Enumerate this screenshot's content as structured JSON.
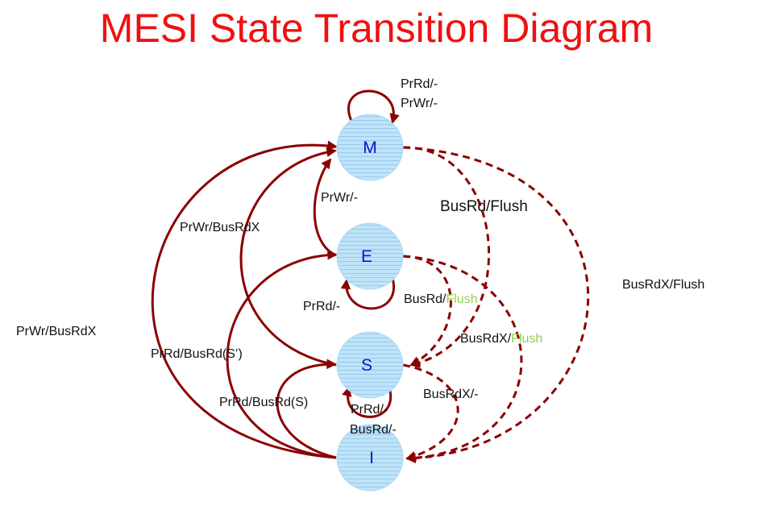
{
  "title": "MESI State Transition Diagram",
  "colors": {
    "title": "#ee1111",
    "edge": "#8b0000",
    "node_fill": "#bde4f8",
    "node_lines": "#9fc8ea",
    "node_text": "#1010d0",
    "highlight": "#92d050"
  },
  "states": {
    "m": "M",
    "e": "E",
    "s": "S",
    "i": "I"
  },
  "labels": {
    "m_self_1": "PrRd/-",
    "m_self_2": "PrWr/-",
    "e_to_m": "PrWr/-",
    "s_to_m": "PrWr/BusRdX",
    "i_to_m": "PrWr/BusRdX",
    "e_self": "PrRd/-",
    "i_to_e": "PrRd/BusRd(S’)",
    "i_to_s": "PrRd/BusRd(S)",
    "s_self_1": "PrRd/-",
    "s_self_2": "BusRd/-",
    "m_to_s": "BusRd/Flush",
    "e_to_s_a": "BusRd/",
    "e_to_s_b": "Flush",
    "e_to_i_a": "BusRdX/",
    "e_to_i_b": "Flush",
    "s_to_i": "BusRdX/-",
    "m_to_i": "BusRdX/Flush"
  }
}
